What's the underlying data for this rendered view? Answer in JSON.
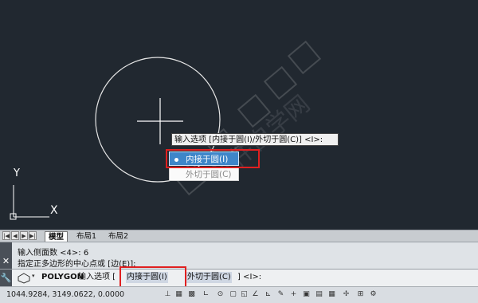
{
  "command_prompt": {
    "text": "输入选项 [内接于圆(I)/外切于圆(C)] <I>:",
    "options": [
      {
        "label": "内接于圆(I)",
        "selected": true
      },
      {
        "label": "外切于圆(C)",
        "selected": false
      }
    ]
  },
  "ucs": {
    "y_label": "Y",
    "x_label": "X"
  },
  "watermark": "软件自学网",
  "layout_tabs": {
    "nav_buttons": [
      "|◀",
      "◀",
      "▶",
      "▶|"
    ],
    "tabs": [
      {
        "label": "模型",
        "active": true
      },
      {
        "label": "布局1",
        "active": false
      },
      {
        "label": "布局2",
        "active": false
      }
    ]
  },
  "command_history": [
    "输入侧面数 <4>: 6",
    "指定正多边形的中心点或 [边(E)]:"
  ],
  "command_line": {
    "command": "POLYGON",
    "prompt": "输入选项 [",
    "option_1": "内接于圆(I)",
    "option_2": "外切于圆(C)",
    "suffix": "] <I>:"
  },
  "status_bar": {
    "coordinates": "1044.9284, 3149.0622, 0.0000"
  },
  "colors": {
    "canvas_bg": "#212830",
    "highlight": "#3e86c9",
    "annotation_red": "#e02020"
  }
}
